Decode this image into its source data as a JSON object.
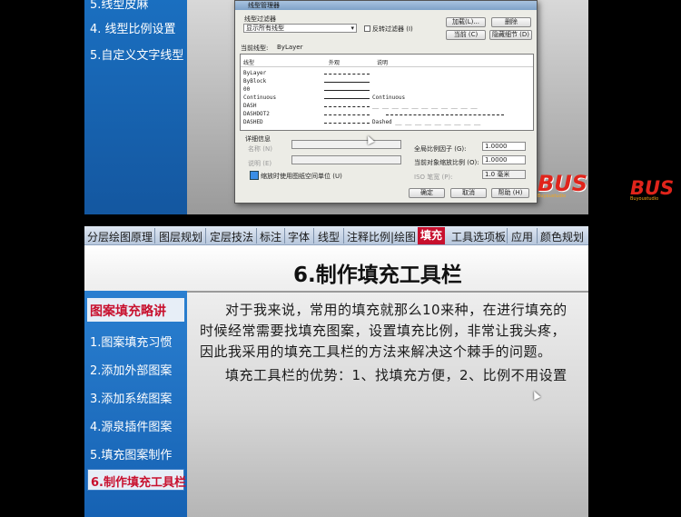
{
  "top": {
    "left_items": [
      "5.线型皮麻",
      "4. 线型比例设置",
      "5.自定义文字线型"
    ],
    "dialog": {
      "title": "线型管理器",
      "filter_label": "线型过滤器",
      "filter_value": "显示所有线型",
      "invert_label": "反转过滤器 (I)",
      "load_button": "加载(L)...",
      "delete_button": "删除",
      "current_button": "当前 (C)",
      "hide_details_button": "隐藏细节 (D)",
      "current_linetype_label": "当前线型:",
      "current_linetype_value": "ByLayer",
      "columns": [
        "线型",
        "外观",
        "说明"
      ],
      "rows": [
        {
          "name": "ByLayer",
          "desc": ""
        },
        {
          "name": "ByBlock",
          "desc": ""
        },
        {
          "name": "00",
          "desc": ""
        },
        {
          "name": "Continuous",
          "desc": "Continuous"
        },
        {
          "name": "DASH",
          "desc": "__ __ __ __ __ __ __ __ __ __ __"
        },
        {
          "name": "DASHDOT2",
          "desc": ""
        },
        {
          "name": "DASHED",
          "desc": "Dashed __ __ __ __ __ __ __ __ __"
        }
      ],
      "details_label": "详细信息",
      "name_label": "名称 (N)",
      "desc_label": "说明 (E)",
      "global_scale_label": "全局比例因子 (G):",
      "global_scale_value": "1.0000",
      "current_scale_label": "当前对象缩放比例 (O):",
      "current_scale_value": "1.0000",
      "paperspace_label": "缩放时使用图纸空间单位 (U)",
      "pen_label": "ISO 笔宽 (P):",
      "pen_value": "1.0 毫米",
      "ok_button": "确定",
      "cancel_button": "取消",
      "help_button": "帮助 (H)"
    },
    "logo_text": "BUS",
    "logo_sub": "Buyoustudio"
  },
  "tabs": [
    "分层绘图原理",
    "图层规划",
    "定层技法",
    "标注",
    "字体",
    "线型",
    "注释比例|绘图",
    "填充",
    "工具选项板",
    "应用",
    "颜色规划"
  ],
  "active_tab_index": 7,
  "slide": {
    "title": "6.制作填充工具栏",
    "sidebar_header": "图案填充略讲",
    "sidebar_items": [
      "1.图案填充习惯",
      "2.添加外部图案",
      "3.添加系统图案",
      "4.源泉插件图案",
      "5.填充图案制作"
    ],
    "sidebar_active": "6.制作填充工具栏",
    "paragraphs": [
      "对于我来说，常用的填充就那么10来种，在进行填充的",
      "时候经常需要找填充图案，设置填充比例，非常让我头疼，",
      "因此我采用的填充工具栏的方法来解决这个棘手的问题。",
      "填充工具栏的优势：1、找填充方便，2、比例不用设置"
    ]
  },
  "colors": {
    "accent_red": "#c8102e",
    "sidebar_blue": "#1a6fc0"
  }
}
